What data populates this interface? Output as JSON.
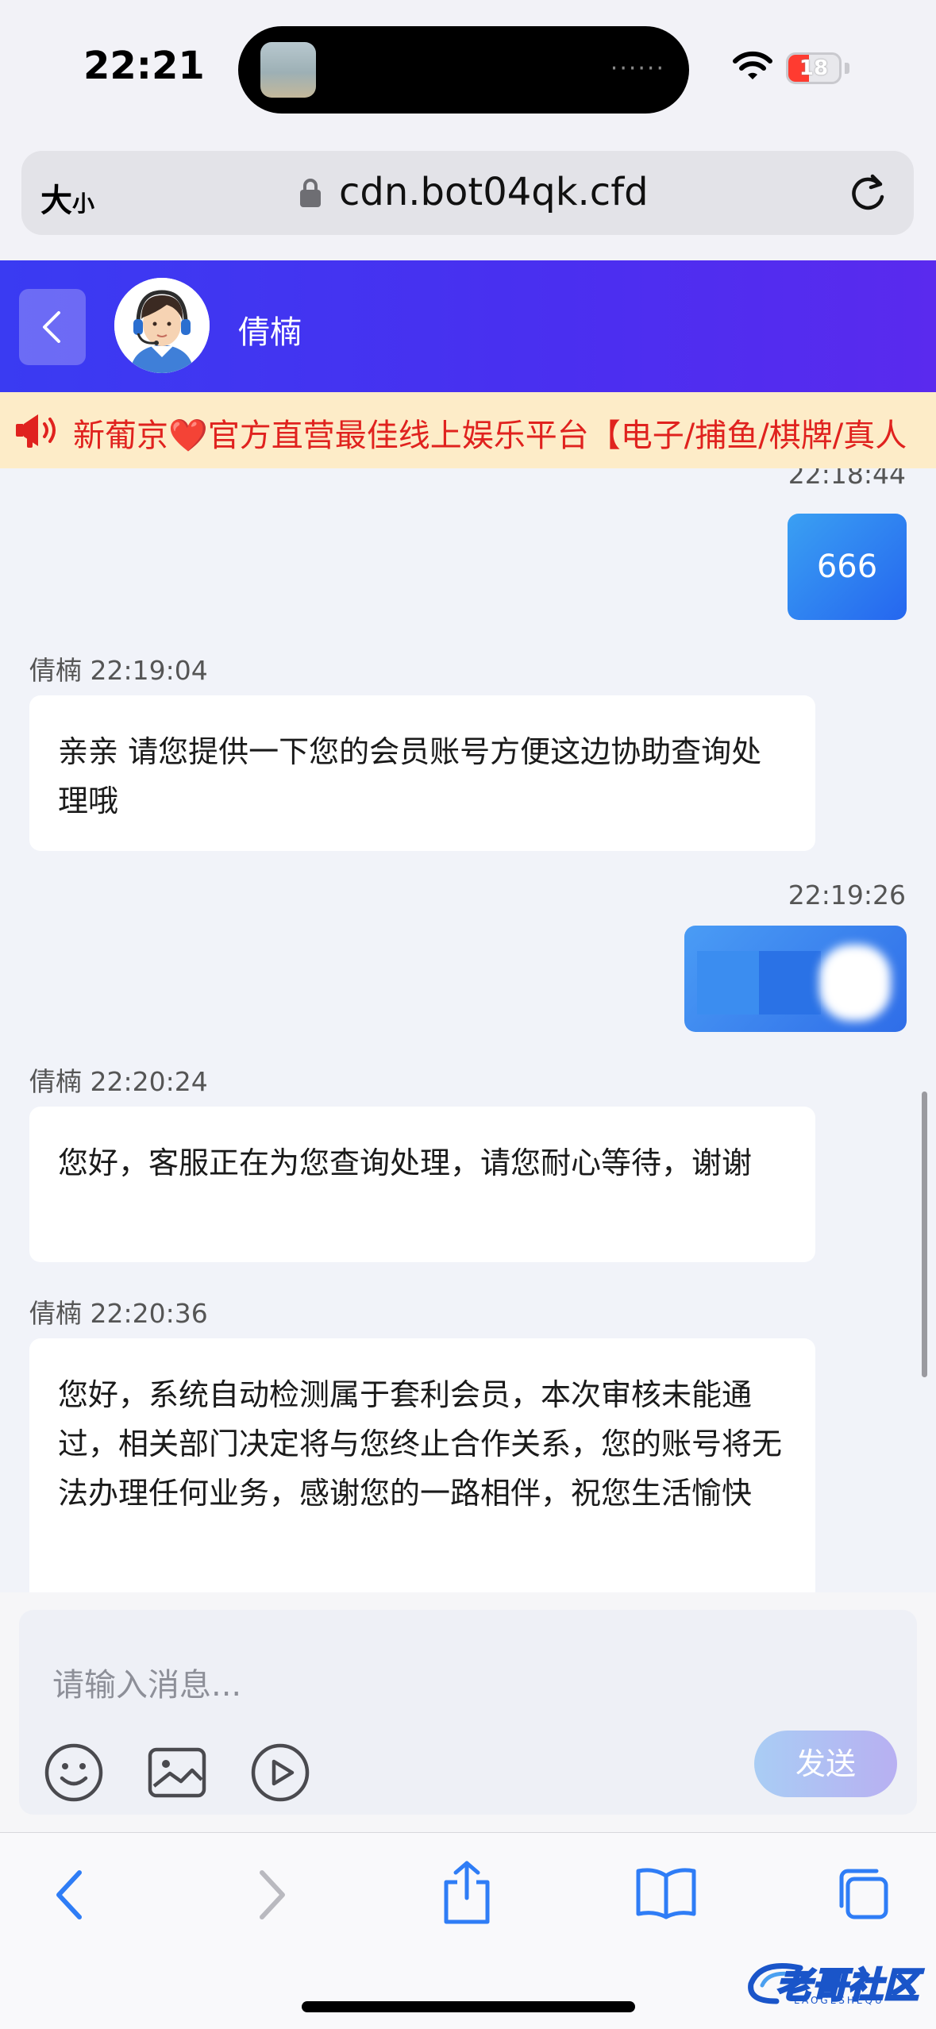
{
  "status_bar": {
    "time": "22:21",
    "battery": "18",
    "island_dots": "······"
  },
  "browser": {
    "text_size_label_big": "大",
    "text_size_label_small": "小",
    "url": "cdn.bot04qk.cfd"
  },
  "chat_header": {
    "agent_name": "倩楠"
  },
  "marquee": {
    "text_before_heart": "新葡京",
    "heart": "❤️",
    "text_after_heart": "官方直营最佳线上娱乐平台【电子/捕鱼/棋牌/真人"
  },
  "messages": {
    "clipped_timestamp": "22:18:44",
    "m1_text": "666",
    "m2_header": "倩楠 22:19:04",
    "m2_text": "亲亲 请您提供一下您的会员账号方便这边协助查询处理哦",
    "m3_timestamp": "22:19:26",
    "m4_header": "倩楠 22:20:24",
    "m4_text": "您好，客服正在为您查询处理，请您耐心等待，谢谢",
    "m5_header": "倩楠 22:20:36",
    "m5_text": "您好，系统自动检测属于套利会员，本次审核未能通过，相关部门决定将与您终止合作关系，您的账号将无法办理任何业务，感谢您的一路相伴，祝您生活愉快"
  },
  "composer": {
    "placeholder": "请输入消息...",
    "send_label": "发送"
  },
  "watermark": {
    "text": "老哥社区",
    "sub": "LAOGESHEQU"
  },
  "colors": {
    "header_gradient_start": "#3a3bf2",
    "header_gradient_end": "#5a2aee",
    "marquee_bg": "#fdecc8",
    "marquee_text": "#e0221e",
    "bubble_out": "#2f7ff1",
    "safari_icon": "#2f7df6"
  },
  "icons": [
    "back-arrow-icon",
    "lock-icon",
    "reload-icon",
    "speaker-icon",
    "emoji-icon",
    "image-icon",
    "play-icon",
    "nav-back-icon",
    "nav-forward-icon",
    "share-icon",
    "bookmarks-icon",
    "tabs-icon",
    "wifi-icon"
  ]
}
